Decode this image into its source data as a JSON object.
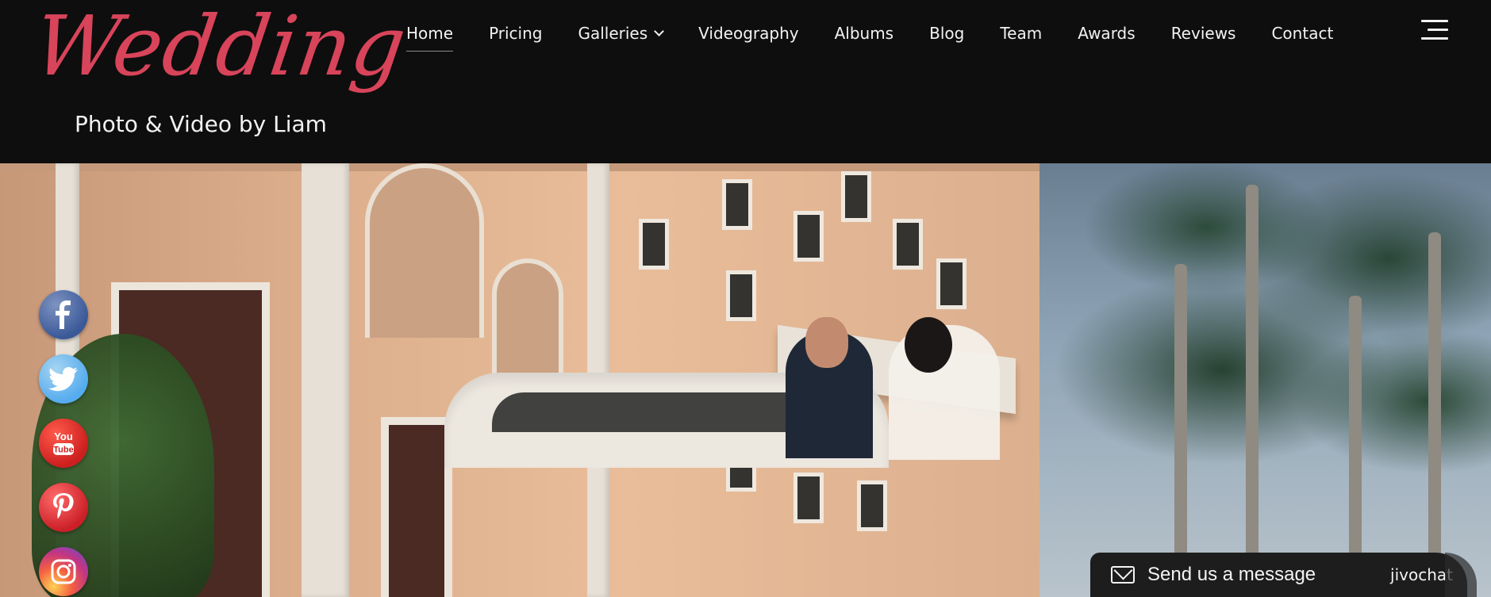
{
  "header": {
    "logo": {
      "script": "Wedding",
      "subtitle": "Photo & Video by Liam"
    },
    "nav": [
      {
        "label": "Home",
        "active": true
      },
      {
        "label": "Pricing"
      },
      {
        "label": "Galleries",
        "has_dropdown": true
      },
      {
        "label": "Videography"
      },
      {
        "label": "Albums"
      },
      {
        "label": "Blog"
      },
      {
        "label": "Team"
      },
      {
        "label": "Awards"
      },
      {
        "label": "Reviews"
      },
      {
        "label": "Contact"
      }
    ],
    "menu_icon": "hamburger-icon"
  },
  "social": [
    {
      "name": "facebook-icon",
      "color": "#3b5998"
    },
    {
      "name": "twitter-icon",
      "color": "#55acee"
    },
    {
      "name": "youtube-icon",
      "color": "#cc1f1f",
      "text_top": "You",
      "text_bottom": "Tube"
    },
    {
      "name": "pinterest-icon",
      "color": "#cb2027"
    },
    {
      "name": "instagram-icon",
      "color": "#c13584"
    }
  ],
  "chat": {
    "label": "Send us a message",
    "brand": "jivochat",
    "icon": "envelope-icon"
  },
  "colors": {
    "header_bg": "#0e0e0e",
    "logo_script": "#d8445a",
    "text": "#f2f2f2"
  }
}
